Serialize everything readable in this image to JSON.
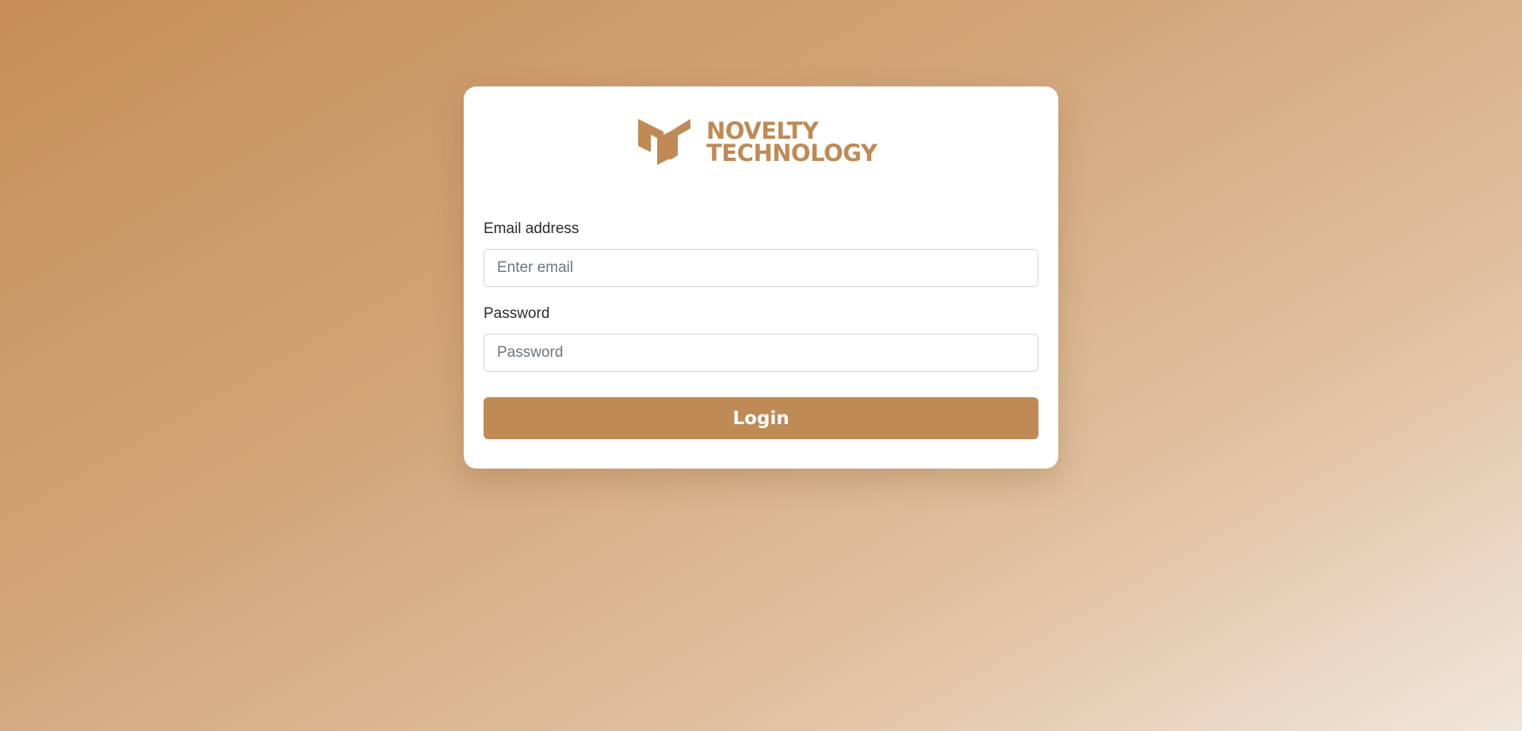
{
  "brand": {
    "line1": "NOVELTY",
    "line2": "TECHNOLOGY",
    "accent_color": "#bf8a56",
    "logo_icon": "novelty-logo-icon"
  },
  "form": {
    "email": {
      "label": "Email address",
      "placeholder": "Enter email",
      "value": ""
    },
    "password": {
      "label": "Password",
      "placeholder": "Password",
      "value": ""
    },
    "submit_label": "Login"
  }
}
